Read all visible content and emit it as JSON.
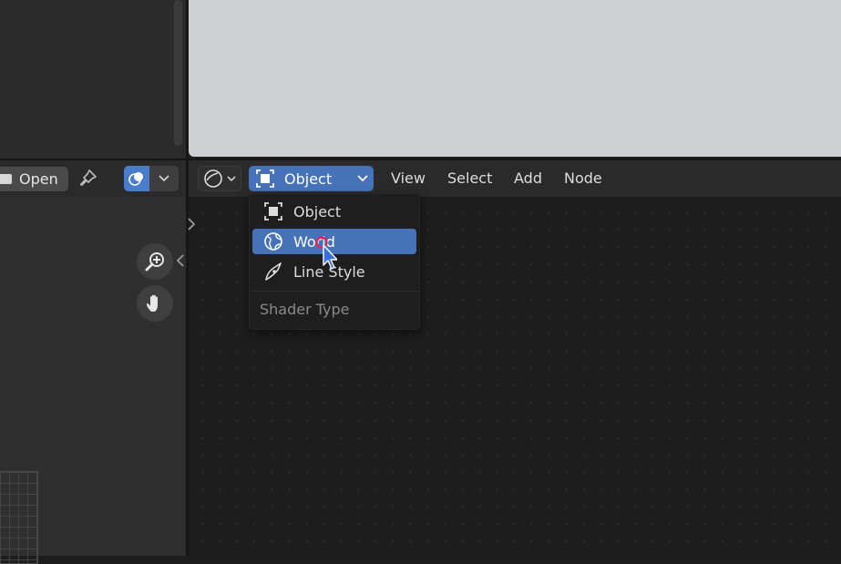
{
  "left_panel": {
    "open_label": "Open"
  },
  "node_editor": {
    "header": {
      "shader_type_value": "Object",
      "menus": [
        "View",
        "Select",
        "Add",
        "Node"
      ]
    },
    "dropdown": {
      "items": [
        {
          "label": "Object",
          "icon": "object-icon",
          "active": false
        },
        {
          "label": "World",
          "icon": "world-icon",
          "active": true
        },
        {
          "label": "Line Style",
          "icon": "line-style-icon",
          "active": false
        }
      ],
      "section_label": "Shader Type"
    }
  },
  "colors": {
    "accent": "#4672b9",
    "background": "#1d1d1d",
    "viewport_top": "#cdcfd3"
  }
}
